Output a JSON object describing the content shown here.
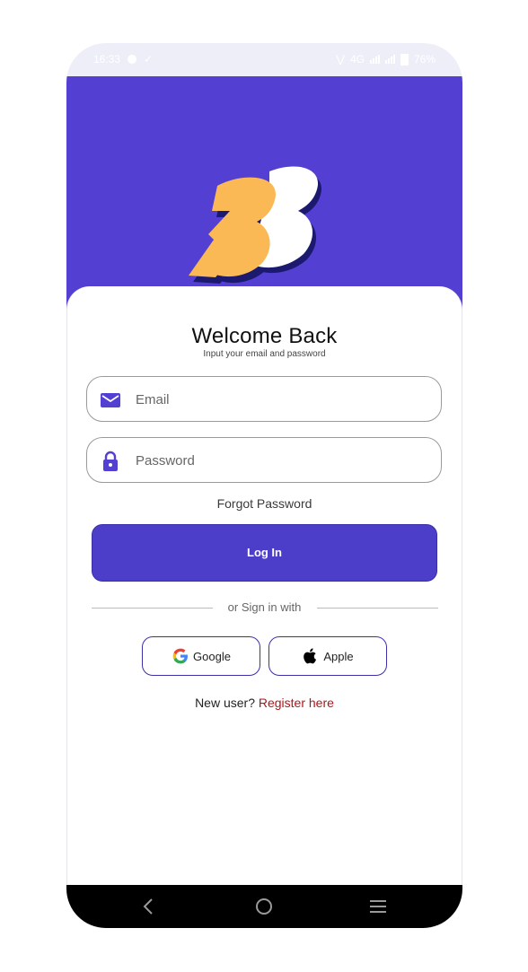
{
  "status_bar": {
    "time": "16:33",
    "network": "4G",
    "battery": "76%"
  },
  "login": {
    "title": "Welcome Back",
    "subtitle": "Input your email and password",
    "email_placeholder": "Email",
    "password_placeholder": "Password",
    "forgot_label": "Forgot Password",
    "login_label": "Log In",
    "divider_text": "or Sign in with",
    "google_label": "Google",
    "apple_label": "Apple",
    "new_user_text": "New user?",
    "register_label": "Register here"
  },
  "icons": {
    "email": "envelope-icon",
    "password": "lock-icon",
    "google": "google-g-icon",
    "apple": "apple-logo-icon",
    "nav_back": "back-icon",
    "nav_home": "home-icon",
    "nav_recents": "menu-icon"
  },
  "colors": {
    "brand": "#5340d3",
    "button": "#4d3ec9",
    "logo_orange": "#fbb955",
    "register_link": "#b0141a"
  }
}
